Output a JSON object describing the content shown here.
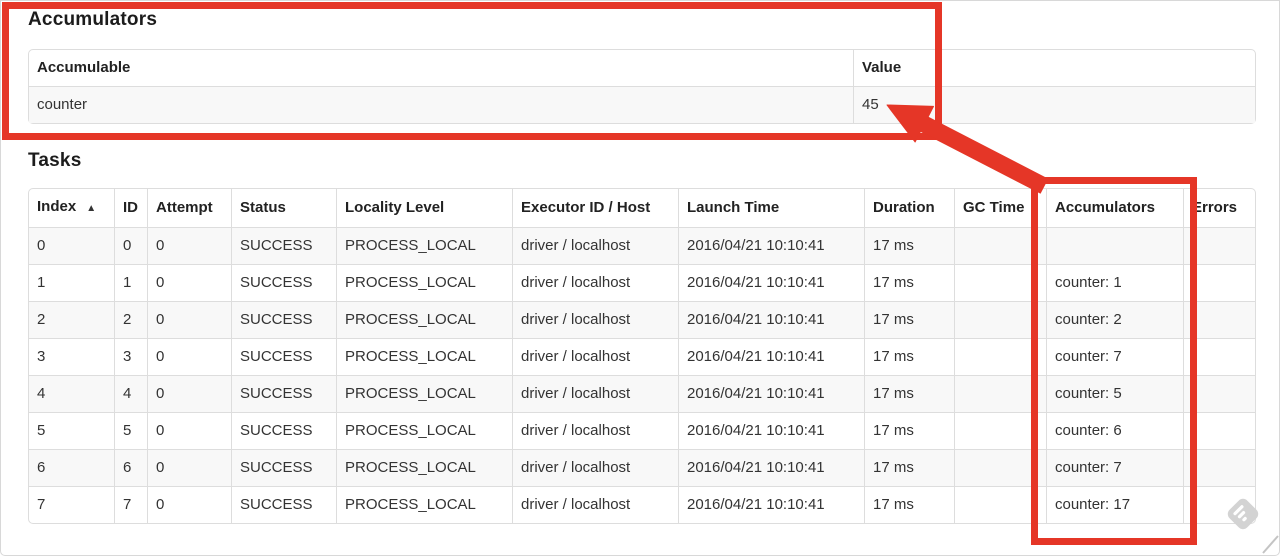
{
  "accumulators_section": {
    "title": "Accumulators",
    "table": {
      "headers": [
        "Accumulable",
        "Value"
      ],
      "rows": [
        {
          "accumulable": "counter",
          "value": "45"
        }
      ]
    }
  },
  "tasks_section": {
    "title": "Tasks",
    "sort_indicator": "▲",
    "table": {
      "headers": [
        "Index",
        "ID",
        "Attempt",
        "Status",
        "Locality Level",
        "Executor ID / Host",
        "Launch Time",
        "Duration",
        "GC Time",
        "Accumulators",
        "Errors"
      ],
      "rows": [
        [
          "0",
          "0",
          "0",
          "SUCCESS",
          "PROCESS_LOCAL",
          "driver / localhost",
          "2016/04/21 10:10:41",
          "17 ms",
          "",
          "",
          ""
        ],
        [
          "1",
          "1",
          "0",
          "SUCCESS",
          "PROCESS_LOCAL",
          "driver / localhost",
          "2016/04/21 10:10:41",
          "17 ms",
          "",
          "counter: 1",
          ""
        ],
        [
          "2",
          "2",
          "0",
          "SUCCESS",
          "PROCESS_LOCAL",
          "driver / localhost",
          "2016/04/21 10:10:41",
          "17 ms",
          "",
          "counter: 2",
          ""
        ],
        [
          "3",
          "3",
          "0",
          "SUCCESS",
          "PROCESS_LOCAL",
          "driver / localhost",
          "2016/04/21 10:10:41",
          "17 ms",
          "",
          "counter: 7",
          ""
        ],
        [
          "4",
          "4",
          "0",
          "SUCCESS",
          "PROCESS_LOCAL",
          "driver / localhost",
          "2016/04/21 10:10:41",
          "17 ms",
          "",
          "counter: 5",
          ""
        ],
        [
          "5",
          "5",
          "0",
          "SUCCESS",
          "PROCESS_LOCAL",
          "driver / localhost",
          "2016/04/21 10:10:41",
          "17 ms",
          "",
          "counter: 6",
          ""
        ],
        [
          "6",
          "6",
          "0",
          "SUCCESS",
          "PROCESS_LOCAL",
          "driver / localhost",
          "2016/04/21 10:10:41",
          "17 ms",
          "",
          "counter: 7",
          ""
        ],
        [
          "7",
          "7",
          "0",
          "SUCCESS",
          "PROCESS_LOCAL",
          "driver / localhost",
          "2016/04/21 10:10:41",
          "17 ms",
          "",
          "counter: 17",
          ""
        ]
      ]
    }
  },
  "annotations": {
    "highlight_color": "#e53627",
    "watermark_color": "#d3d3d3",
    "boxed_regions": [
      "accumulators-summary",
      "tasks-accumulators-column"
    ],
    "arrow_target": "45"
  }
}
